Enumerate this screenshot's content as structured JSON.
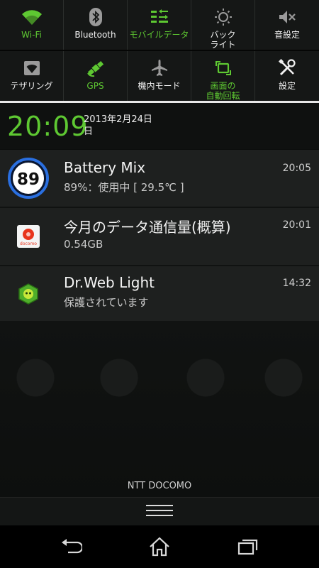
{
  "quick_settings": {
    "row1": [
      {
        "label": "Wi-Fi",
        "icon": "wifi-icon",
        "active": true
      },
      {
        "label": "Bluetooth",
        "icon": "bluetooth-icon",
        "active": false
      },
      {
        "label": "モバイルデータ",
        "icon": "mobile-data-icon",
        "active": true
      },
      {
        "label": "バック\nライト",
        "icon": "backlight-icon",
        "active": false
      },
      {
        "label": "音設定",
        "icon": "sound-icon",
        "active": false
      }
    ],
    "row2": [
      {
        "label": "テザリング",
        "icon": "tethering-icon",
        "active": false
      },
      {
        "label": "GPS",
        "icon": "gps-icon",
        "active": true
      },
      {
        "label": "機内モード",
        "icon": "airplane-icon",
        "active": false
      },
      {
        "label": "画面の\n自動回転",
        "icon": "auto-rotate-icon",
        "active": true
      },
      {
        "label": "設定",
        "icon": "settings-icon",
        "active": false
      }
    ]
  },
  "clock": {
    "time": "20:09",
    "date": "2013年2月24日\n日"
  },
  "notifications": [
    {
      "app": "battery-mix",
      "title": "Battery Mix",
      "subtitle": "89%：使用中 [ 29.5℃ ]",
      "time": "20:05",
      "icon": "battery-mix-icon",
      "badge": "89"
    },
    {
      "app": "docomo",
      "title": "今月のデータ通信量(概算)",
      "subtitle": "0.54GB",
      "time": "20:01",
      "icon": "docomo-icon",
      "badge": "docomo"
    },
    {
      "app": "drweb",
      "title": "Dr.Web Light",
      "subtitle": "保護されています",
      "time": "14:32",
      "icon": "drweb-icon"
    }
  ],
  "carrier": "NTT DOCOMO",
  "colors": {
    "accent": "#5ec832",
    "background": "#0b0d0c",
    "notification_bg": "#1e201f",
    "battery_ring": "#2a6fe0",
    "docomo_red": "#e8341c"
  },
  "navigation": [
    {
      "name": "back-icon"
    },
    {
      "name": "home-icon"
    },
    {
      "name": "recent-apps-icon"
    }
  ]
}
